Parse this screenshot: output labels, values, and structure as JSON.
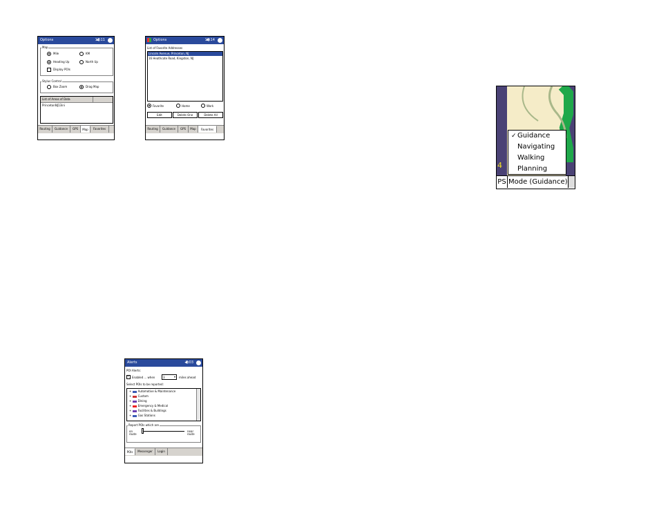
{
  "options_map": {
    "title": "Options",
    "time": "12:11",
    "group_map": "Map",
    "mile": "Mile",
    "km": "KM",
    "heading_up": "Heading Up",
    "north_up": "North Up",
    "display_pois": "Display POIs",
    "group_stylus": "Stylus Control",
    "box_zoom": "Box Zoom",
    "drag_map": "Drag Map",
    "list_header": "List of Areas of Data",
    "list_item": "PrincetonNJ13ini",
    "tabs": [
      "Routing",
      "Guidance",
      "GPS",
      "Map",
      "Favorites"
    ]
  },
  "options_fav": {
    "title": "Options",
    "time": "10:14",
    "list_label": "List of Favorite Addresses",
    "items": [
      "Lincoln Avenue, Princeton, NJ",
      "16 Heathcote Road, Kingston, NJ"
    ],
    "favorite": "Favorite",
    "home": "Home",
    "work": "Work",
    "edit": "Edit",
    "delete_one": "Delete One",
    "delete_all": "Delete All",
    "tabs": [
      "Routing",
      "Guidance",
      "GPS",
      "Map",
      "Favorites"
    ]
  },
  "alerts": {
    "title": "Alerts",
    "time": "9:03",
    "poi_alerts": "POI Alerts:",
    "enabled": "Enabled ... when",
    "miles_value": "3",
    "miles_ahead": "miles ahead",
    "select_label": "Select POIs to be reported:",
    "pois": [
      "Automotive & Maintenance",
      "Custom",
      "Dining",
      "Emergency & Medical",
      "Facilities & Buildings",
      "Gas Stations"
    ],
    "report_label": "Report POIs which are",
    "on_route": "on route",
    "near_route": "near route",
    "tabs": [
      "POIs",
      "Messenger",
      "Login"
    ]
  },
  "mode_menu": {
    "items": [
      "Guidance",
      "Navigating",
      "Walking",
      "Planning"
    ],
    "checked": "Guidance",
    "bar_left": "PS",
    "bar_mode": "Mode (Guidance)",
    "side_number": "4"
  }
}
